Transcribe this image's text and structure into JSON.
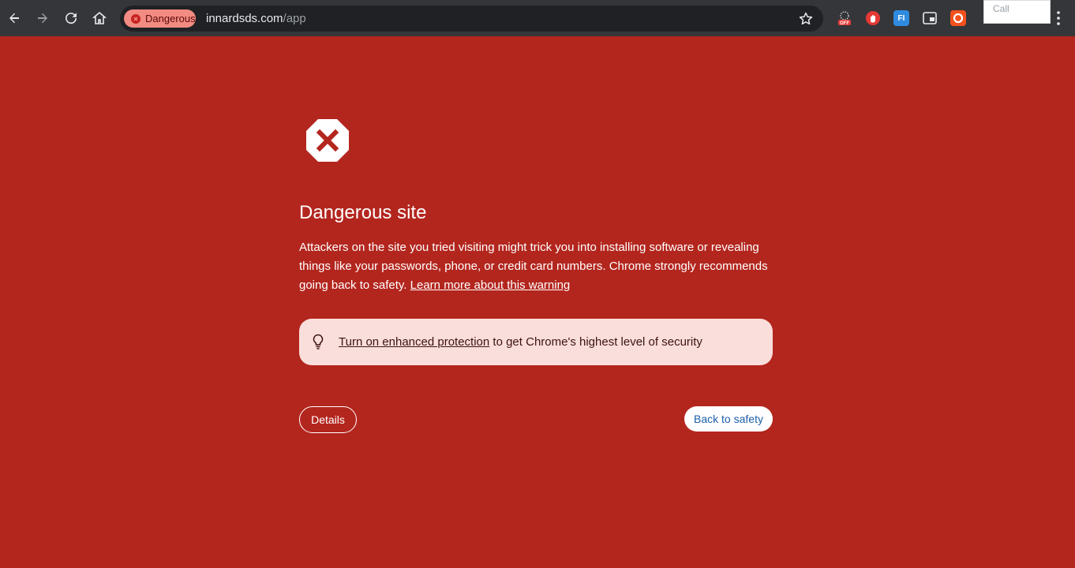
{
  "browser": {
    "security_chip": "Dangerous",
    "url_domain": "innardsds.com",
    "url_path": "/app",
    "nav_icons": [
      "back-icon",
      "forward-icon",
      "reload-icon",
      "home-icon"
    ],
    "extensions": [
      "off-extension-icon",
      "red-hand-extension-icon",
      "fi-extension-icon",
      "window-extension-icon",
      "orange-ring-extension-icon"
    ],
    "extension_fi_label": "FI",
    "extension_off_label": "OFF",
    "popup_text": "Call"
  },
  "interstitial": {
    "title": "Dangerous site",
    "description": "Attackers on the site you tried visiting might trick you into installing software or revealing things like your passwords, phone, or credit card numbers. Chrome strongly recommends going back to safety.",
    "learn_more": "Learn more about this warning",
    "promo_link": "Turn on enhanced protection",
    "promo_rest": " to get Chrome's highest level of security",
    "details_button": "Details",
    "back_button": "Back to safety"
  },
  "colors": {
    "page_background": "#b3261e",
    "promo_background": "#fadedb",
    "toolbar": "#35363a",
    "chip": "#f28b82"
  }
}
